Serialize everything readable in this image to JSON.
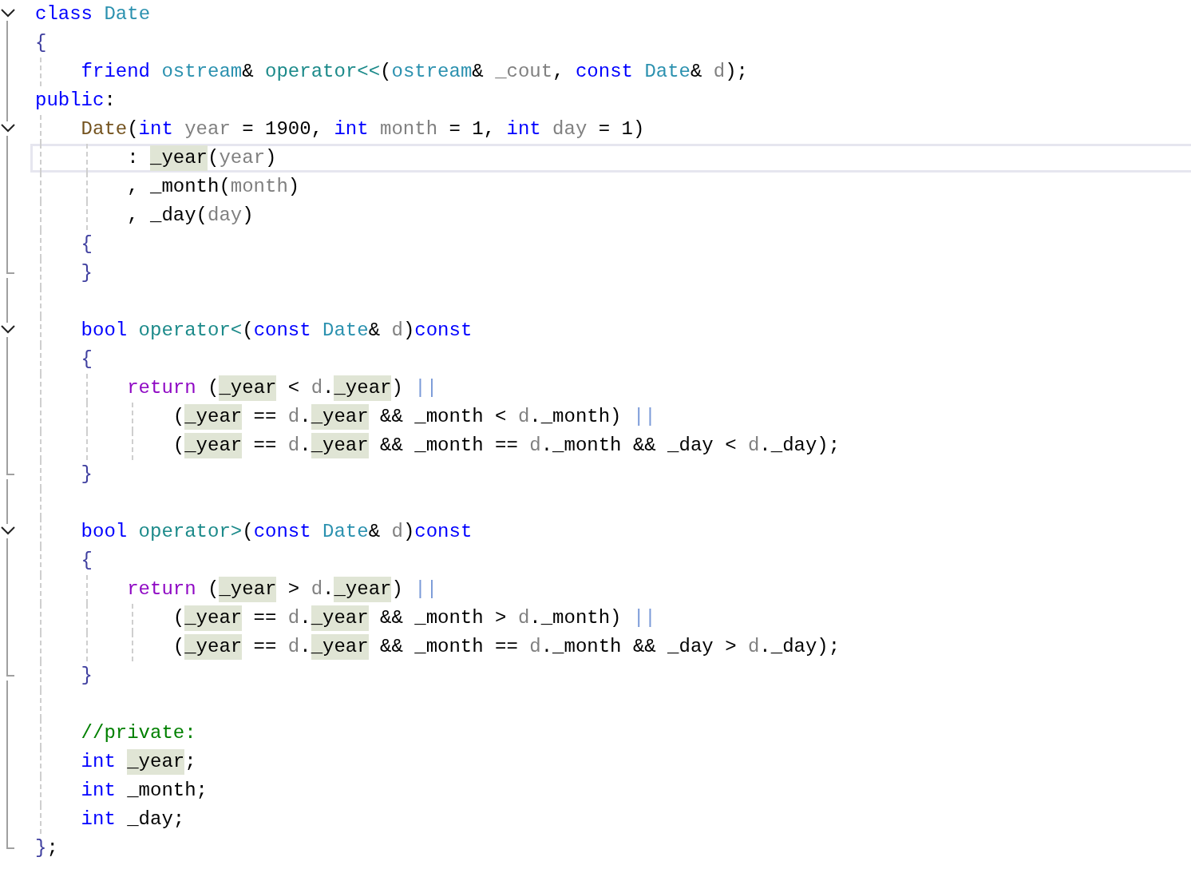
{
  "lines": [
    {
      "expanded": true,
      "tokens": [
        {
          "kind": "keyword",
          "text": "class "
        },
        {
          "kind": "type",
          "text": "Date"
        }
      ]
    },
    {
      "tokens": [
        {
          "kind": "brace",
          "text": "{"
        }
      ],
      "children": [
        {
          "tokens": [
            {
              "kind": "keyword",
              "text": "friend "
            },
            {
              "kind": "type",
              "text": "ostream"
            },
            {
              "kind": "plain",
              "text": "& "
            },
            {
              "kind": "function",
              "text": "operator<<"
            },
            {
              "kind": "plain",
              "text": "("
            },
            {
              "kind": "type",
              "text": "ostream"
            },
            {
              "kind": "plain",
              "text": "& "
            },
            {
              "kind": "param",
              "text": "_cout"
            },
            {
              "kind": "plain",
              "text": ", "
            },
            {
              "kind": "keyword",
              "text": "const "
            },
            {
              "kind": "type",
              "text": "Date"
            },
            {
              "kind": "plain",
              "text": "& "
            },
            {
              "kind": "param",
              "text": "d"
            },
            {
              "kind": "plain",
              "text": ");"
            }
          ]
        }
      ]
    },
    {
      "tokens": [
        {
          "kind": "keyword",
          "text": "public"
        },
        {
          "kind": "plain",
          "text": ":"
        }
      ],
      "children": [
        {
          "expanded": true,
          "tokens": [
            {
              "kind": "ctor",
              "text": "Date"
            },
            {
              "kind": "plain",
              "text": "("
            },
            {
              "kind": "keyword",
              "text": "int "
            },
            {
              "kind": "param",
              "text": "year"
            },
            {
              "kind": "plain",
              "text": " = 1900, "
            },
            {
              "kind": "keyword",
              "text": "int "
            },
            {
              "kind": "param",
              "text": "month"
            },
            {
              "kind": "plain",
              "text": " = 1, "
            },
            {
              "kind": "keyword",
              "text": "int "
            },
            {
              "kind": "param",
              "text": "day"
            },
            {
              "kind": "plain",
              "text": " = 1)"
            }
          ],
          "children": [
            {
              "current": true,
              "tokens": [
                {
                  "kind": "plain",
                  "text": ": "
                },
                {
                  "kind": "member",
                  "text": "_year",
                  "highlighted": true
                },
                {
                  "kind": "plain",
                  "text": "("
                },
                {
                  "kind": "param",
                  "text": "year"
                },
                {
                  "kind": "plain",
                  "text": ")"
                }
              ]
            },
            {
              "tokens": [
                {
                  "kind": "plain",
                  "text": ", _month("
                },
                {
                  "kind": "param",
                  "text": "month"
                },
                {
                  "kind": "plain",
                  "text": ")"
                }
              ]
            },
            {
              "tokens": [
                {
                  "kind": "plain",
                  "text": ", _day("
                },
                {
                  "kind": "param",
                  "text": "day"
                },
                {
                  "kind": "plain",
                  "text": ")"
                }
              ]
            }
          ]
        },
        {
          "tokens": [
            {
              "kind": "brace",
              "text": "{"
            }
          ]
        },
        {
          "fold_end": true,
          "blank_after": true,
          "tokens": [
            {
              "kind": "brace",
              "text": "}"
            }
          ]
        },
        {
          "expanded": true,
          "tokens": [
            {
              "kind": "keyword",
              "text": "bool "
            },
            {
              "kind": "function",
              "text": "operator<"
            },
            {
              "kind": "plain",
              "text": "("
            },
            {
              "kind": "keyword",
              "text": "const "
            },
            {
              "kind": "type",
              "text": "Date"
            },
            {
              "kind": "plain",
              "text": "& "
            },
            {
              "kind": "param",
              "text": "d"
            },
            {
              "kind": "plain",
              "text": ")"
            },
            {
              "kind": "keyword",
              "text": "const"
            }
          ]
        },
        {
          "tokens": [
            {
              "kind": "brace",
              "text": "{"
            }
          ],
          "children": [
            {
              "tokens": [
                {
                  "kind": "return",
                  "text": "return "
                },
                {
                  "kind": "plain",
                  "text": "("
                },
                {
                  "kind": "member",
                  "text": "_year",
                  "highlighted": true
                },
                {
                  "kind": "plain",
                  "text": " < "
                },
                {
                  "kind": "param",
                  "text": "d"
                },
                {
                  "kind": "plain",
                  "text": "."
                },
                {
                  "kind": "member",
                  "text": "_year",
                  "highlighted": true
                },
                {
                  "kind": "plain",
                  "text": ") "
                },
                {
                  "kind": "operator",
                  "text": "||"
                }
              ],
              "children": [
                {
                  "tokens": [
                    {
                      "kind": "plain",
                      "text": "("
                    },
                    {
                      "kind": "member",
                      "text": "_year",
                      "highlighted": true
                    },
                    {
                      "kind": "plain",
                      "text": " == "
                    },
                    {
                      "kind": "param",
                      "text": "d"
                    },
                    {
                      "kind": "plain",
                      "text": "."
                    },
                    {
                      "kind": "member",
                      "text": "_year",
                      "highlighted": true
                    },
                    {
                      "kind": "plain",
                      "text": " && _month < "
                    },
                    {
                      "kind": "param",
                      "text": "d"
                    },
                    {
                      "kind": "plain",
                      "text": "._month) "
                    },
                    {
                      "kind": "operator",
                      "text": "||"
                    }
                  ]
                },
                {
                  "tokens": [
                    {
                      "kind": "plain",
                      "text": "("
                    },
                    {
                      "kind": "member",
                      "text": "_year",
                      "highlighted": true
                    },
                    {
                      "kind": "plain",
                      "text": " == "
                    },
                    {
                      "kind": "param",
                      "text": "d"
                    },
                    {
                      "kind": "plain",
                      "text": "."
                    },
                    {
                      "kind": "member",
                      "text": "_year",
                      "highlighted": true
                    },
                    {
                      "kind": "plain",
                      "text": " && _month == "
                    },
                    {
                      "kind": "param",
                      "text": "d"
                    },
                    {
                      "kind": "plain",
                      "text": "._month && _day < "
                    },
                    {
                      "kind": "param",
                      "text": "d"
                    },
                    {
                      "kind": "plain",
                      "text": "._day);"
                    }
                  ]
                }
              ]
            }
          ]
        },
        {
          "fold_end": true,
          "blank_after": true,
          "tokens": [
            {
              "kind": "brace",
              "text": "}"
            }
          ]
        },
        {
          "expanded": true,
          "tokens": [
            {
              "kind": "keyword",
              "text": "bool "
            },
            {
              "kind": "function",
              "text": "operator>"
            },
            {
              "kind": "plain",
              "text": "("
            },
            {
              "kind": "keyword",
              "text": "const "
            },
            {
              "kind": "type",
              "text": "Date"
            },
            {
              "kind": "plain",
              "text": "& "
            },
            {
              "kind": "param",
              "text": "d"
            },
            {
              "kind": "plain",
              "text": ")"
            },
            {
              "kind": "keyword",
              "text": "const"
            }
          ]
        },
        {
          "tokens": [
            {
              "kind": "brace",
              "text": "{"
            }
          ],
          "children": [
            {
              "tokens": [
                {
                  "kind": "return",
                  "text": "return "
                },
                {
                  "kind": "plain",
                  "text": "("
                },
                {
                  "kind": "member",
                  "text": "_year",
                  "highlighted": true
                },
                {
                  "kind": "plain",
                  "text": " > "
                },
                {
                  "kind": "param",
                  "text": "d"
                },
                {
                  "kind": "plain",
                  "text": "."
                },
                {
                  "kind": "member",
                  "text": "_year",
                  "highlighted": true
                },
                {
                  "kind": "plain",
                  "text": ") "
                },
                {
                  "kind": "operator",
                  "text": "||"
                }
              ],
              "children": [
                {
                  "tokens": [
                    {
                      "kind": "plain",
                      "text": "("
                    },
                    {
                      "kind": "member",
                      "text": "_year",
                      "highlighted": true
                    },
                    {
                      "kind": "plain",
                      "text": " == "
                    },
                    {
                      "kind": "param",
                      "text": "d"
                    },
                    {
                      "kind": "plain",
                      "text": "."
                    },
                    {
                      "kind": "member",
                      "text": "_year",
                      "highlighted": true
                    },
                    {
                      "kind": "plain",
                      "text": " && _month > "
                    },
                    {
                      "kind": "param",
                      "text": "d"
                    },
                    {
                      "kind": "plain",
                      "text": "._month) "
                    },
                    {
                      "kind": "operator",
                      "text": "||"
                    }
                  ]
                },
                {
                  "tokens": [
                    {
                      "kind": "plain",
                      "text": "("
                    },
                    {
                      "kind": "member",
                      "text": "_year",
                      "highlighted": true
                    },
                    {
                      "kind": "plain",
                      "text": " == "
                    },
                    {
                      "kind": "param",
                      "text": "d"
                    },
                    {
                      "kind": "plain",
                      "text": "."
                    },
                    {
                      "kind": "member",
                      "text": "_year",
                      "highlighted": true
                    },
                    {
                      "kind": "plain",
                      "text": " && _month == "
                    },
                    {
                      "kind": "param",
                      "text": "d"
                    },
                    {
                      "kind": "plain",
                      "text": "._month && _day > "
                    },
                    {
                      "kind": "param",
                      "text": "d"
                    },
                    {
                      "kind": "plain",
                      "text": "._day);"
                    }
                  ]
                }
              ]
            }
          ]
        },
        {
          "fold_end": true,
          "blank_after": true,
          "tokens": [
            {
              "kind": "brace",
              "text": "}"
            }
          ]
        },
        {
          "tokens": [
            {
              "kind": "comment",
              "text": "//private:"
            }
          ]
        },
        {
          "tokens": [
            {
              "kind": "keyword",
              "text": "int "
            },
            {
              "kind": "member",
              "text": "_year",
              "highlighted": true
            },
            {
              "kind": "plain",
              "text": ";"
            }
          ]
        },
        {
          "tokens": [
            {
              "kind": "keyword",
              "text": "int "
            },
            {
              "kind": "plain",
              "text": "_month;"
            }
          ]
        },
        {
          "tokens": [
            {
              "kind": "keyword",
              "text": "int "
            },
            {
              "kind": "plain",
              "text": "_day;"
            }
          ]
        }
      ]
    },
    {
      "fold_end": true,
      "tokens": [
        {
          "kind": "brace",
          "text": "}"
        },
        {
          "kind": "plain",
          "text": ";"
        }
      ]
    }
  ]
}
